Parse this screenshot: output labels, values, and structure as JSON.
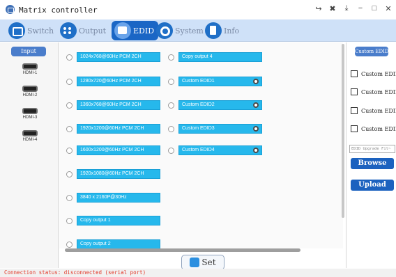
{
  "window": {
    "title": "Matrix controller"
  },
  "toolbar": {
    "tabs": [
      {
        "label": "Switch"
      },
      {
        "label": "Output"
      },
      {
        "label": "EDID"
      },
      {
        "label": "System"
      },
      {
        "label": "Info"
      }
    ],
    "active": "EDID"
  },
  "inputs": {
    "tab_label": "Input",
    "ports": [
      "HDMI-1",
      "HDMI-2",
      "HDMI-3",
      "HDMI-4"
    ]
  },
  "edid": {
    "left_options": [
      "1024x768@60Hz PCM 2CH",
      "1280x720@60Hz PCM 2CH",
      "1360x768@60Hz PCM 2CH",
      "1920x1200@60Hz PCM 2CH",
      "1600x1200@60Hz PCM 2CH",
      "1920x1080@60Hz PCM 2CH",
      "3840 x 2160P@30Hz",
      "Copy output 1",
      "Copy output 2"
    ],
    "right_options": [
      "Copy output 4",
      "Custom EDID1",
      "Custom EDID2",
      "Custom EDID3",
      "Custom EDID4"
    ]
  },
  "set_label": "Set",
  "custom": {
    "tab_label": "Custom EDID",
    "checkboxes": [
      "Custom EDID",
      "Custom EDID",
      "Custom EDID",
      "Custom EDID"
    ],
    "upgrade_placeholder": "EDID Upgrade Fil~",
    "browse_label": "Browse",
    "upload_label": "Upload"
  },
  "status": {
    "text": "Connection status: disconnected (serial port)"
  },
  "colors": {
    "accent": "#1a66c5",
    "pill": "#26b8ec",
    "status_error": "#e23a2a"
  }
}
